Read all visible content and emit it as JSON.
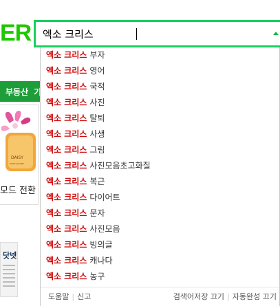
{
  "header": {
    "logo_text": "ER"
  },
  "nav": {
    "real_estate_label": "부동산",
    "more_glyph": "기"
  },
  "promo": {
    "brand_text": "DAISY",
    "sub_text": "MARC JACOBS"
  },
  "mode": {
    "label": "모드 전환"
  },
  "paper": {
    "brand_text": "닷넷"
  },
  "search": {
    "query": "엑소 크리스"
  },
  "suggestions": [
    {
      "match": "엑소 크리스",
      "rest": "부자"
    },
    {
      "match": "엑소 크리스",
      "rest": "영어"
    },
    {
      "match": "엑소 크리스",
      "rest": "국적"
    },
    {
      "match": "엑소 크리스",
      "rest": "사진"
    },
    {
      "match": "엑소 크리스",
      "rest": "탈퇴"
    },
    {
      "match": "엑소 크리스",
      "rest": "사생"
    },
    {
      "match": "엑소 크리스",
      "rest": "그림"
    },
    {
      "match": "엑소 크리스",
      "rest": "사진모음초고화질"
    },
    {
      "match": "엑소 크리스",
      "rest": "복근"
    },
    {
      "match": "엑소 크리스",
      "rest": "다이어트"
    },
    {
      "match": "엑소 크리스",
      "rest": "문자"
    },
    {
      "match": "엑소 크리스",
      "rest": "사진모음"
    },
    {
      "match": "엑소 크리스",
      "rest": "빙의글"
    },
    {
      "match": "엑소 크리스",
      "rest": "캐나다"
    },
    {
      "match": "엑소 크리스",
      "rest": "농구"
    }
  ],
  "footer": {
    "help": "도움말",
    "report": "신고",
    "save_off": "검색어저장 끄기",
    "autocomplete_off": "자동완성 끄기"
  },
  "colors": {
    "brand_green": "#19ce60",
    "match_red": "#d10b0b"
  },
  "icons": {
    "dropdown_arrow": "triangle-up"
  }
}
